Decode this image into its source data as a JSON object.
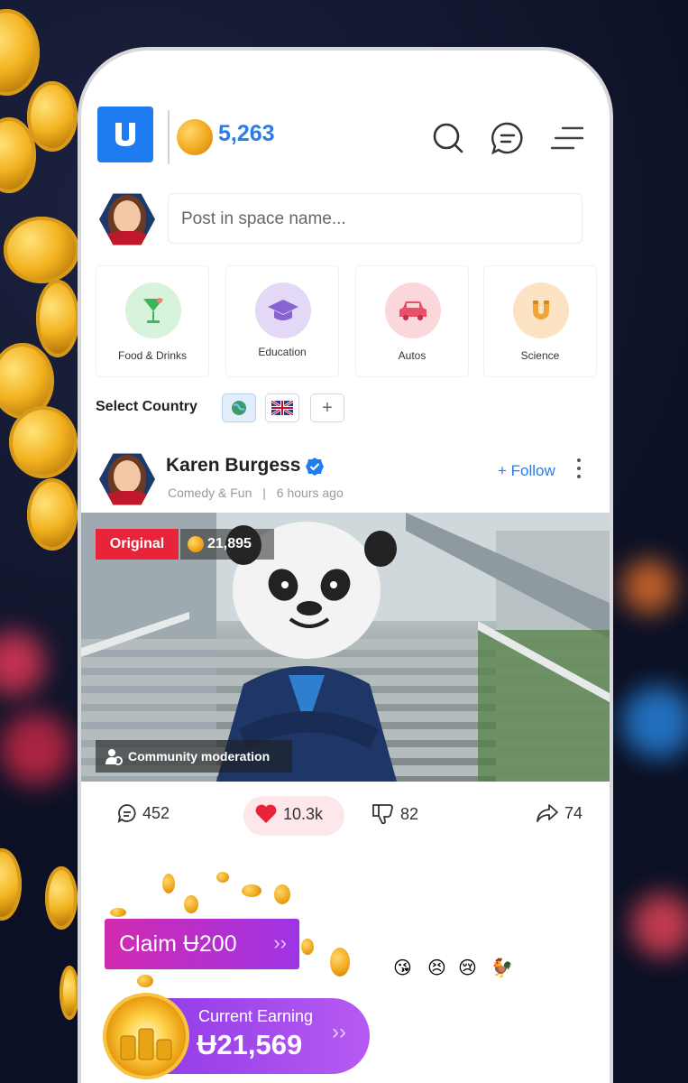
{
  "header": {
    "coin_balance": "5,263"
  },
  "composer": {
    "placeholder": "Post in space name..."
  },
  "categories": [
    {
      "label": "Food & Drinks",
      "icon": "cocktail-icon",
      "color": "#d7f3dc"
    },
    {
      "label": "Education",
      "icon": "graduation-cap-icon",
      "color": "#e3d9f7"
    },
    {
      "label": "Autos",
      "icon": "car-icon",
      "color": "#fbd7db"
    },
    {
      "label": "Science",
      "icon": "magnet-icon",
      "color": "#fbe3c4"
    }
  ],
  "country": {
    "label": "Select Country",
    "add": "+"
  },
  "post": {
    "author": "Karen Burgess",
    "category": "Comedy & Fun",
    "separator": "|",
    "time": "6 hours ago",
    "follow_label": "+ Follow",
    "badge": "Original",
    "coins": "21,895",
    "moderation": "Community moderation",
    "comments": "452",
    "likes": "10.3k",
    "dislikes": "82",
    "shares": "74"
  },
  "rewards": {
    "claim_label": "Claim Ʉ200",
    "earning_label": "Current Earning",
    "earning_value": "Ʉ21,569"
  },
  "colors": {
    "accent": "#2b7be8",
    "brand": "#1e7bf0",
    "badge_red": "#e8233a",
    "claim_pink": "#d12ab0",
    "earn_purple": "#8e37e6"
  }
}
